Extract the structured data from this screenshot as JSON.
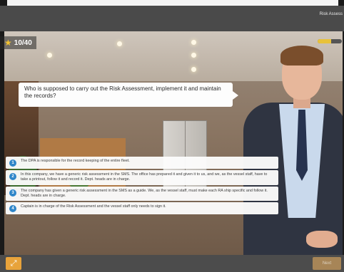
{
  "header": {
    "title": "Risk Assess"
  },
  "score": {
    "label": "10/40",
    "icon": "star-icon"
  },
  "progress": {
    "fraction": 0.55,
    "color": "#e8c23a"
  },
  "question": {
    "text": "Who is supposed to carry out the Risk Assessment, implement it and maintain the records?"
  },
  "answers": [
    {
      "number": "1",
      "text": "The DPA is responsible for the record keeping of the entire fleet."
    },
    {
      "number": "2",
      "text": "In this company, we have a generic risk assessment in the SMS. The office has prepared it and given it to us, and we, as the vessel staff, have to take a printout, follow it and record it. Dept. heads are in charge."
    },
    {
      "number": "3",
      "text": "The company has given a generic risk assessment in the SMS as a guide. We, as the vessel staff, must make each RA ship specific and follow it. Dept. heads are in charge."
    },
    {
      "number": "4",
      "text": "Captain is in charge of the Risk Assessment and the vessel staff only needs to sign it."
    }
  ],
  "bottom": {
    "menu_icon": "expand-icon",
    "next_label": "Next"
  },
  "colors": {
    "accent": "#2f86c9",
    "menu_button": "#e8a33b",
    "header": "#4a4a4a"
  }
}
